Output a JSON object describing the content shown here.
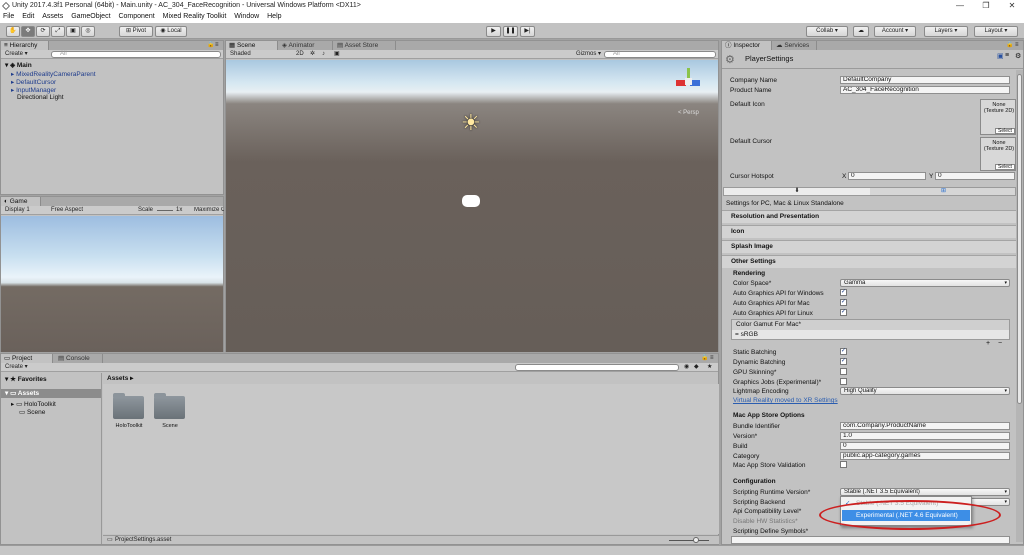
{
  "window": {
    "title": "Unity 2017.4.3f1 Personal (64bit) - Main.unity - AC_304_FaceRecognition - Universal Windows Platform <DX11>",
    "minimize": "—",
    "maximize": "❐",
    "close": "✕"
  },
  "menu": [
    "File",
    "Edit",
    "Assets",
    "GameObject",
    "Component",
    "Mixed Reality Toolkit",
    "Window",
    "Help"
  ],
  "toolbar": {
    "pivot": "Pivot",
    "local": "Local",
    "collab": "Collab ▾",
    "account": "Account",
    "layers": "Layers",
    "layout": "Layout"
  },
  "hierarchy": {
    "tab": "Hierarchy",
    "create": "Create ▾",
    "search_placeholder": "All",
    "scene": "Main",
    "items": [
      "MixedRealityCameraParent",
      "DefaultCursor",
      "InputManager",
      "Directional Light"
    ]
  },
  "scene": {
    "tabs": [
      "Scene",
      "Animator",
      "Asset Store"
    ],
    "shading": "Shaded",
    "mode2d": "2D",
    "gizmos": "Gizmos ▾",
    "search_placeholder": "All",
    "persp": "< Persp"
  },
  "game": {
    "tab": "Game",
    "display": "Display 1",
    "aspect": "Free Aspect",
    "scale_label": "Scale",
    "scale_value": "1x",
    "maximize": "Maximize O"
  },
  "project": {
    "tabs": [
      "Project",
      "Console"
    ],
    "create": "Create ▾",
    "favorites": "Favorites",
    "assets_root": "Assets",
    "tree": [
      "HoloToolkit",
      "Scene"
    ],
    "breadcrumb": "Assets ▸",
    "folders": [
      "HoloToolkit",
      "Scene"
    ],
    "footer_file": "ProjectSettings.asset"
  },
  "inspector": {
    "tabs": [
      "Inspector",
      "Services"
    ],
    "header_title": "PlayerSettings",
    "company_label": "Company Name",
    "company_value": "DefaultCompany",
    "product_label": "Product Name",
    "product_value": "AC_304_FaceRecognition",
    "default_icon_label": "Default Icon",
    "default_cursor_label": "Default Cursor",
    "texture_none": "None (Texture 2D)",
    "select": "Select",
    "cursor_hotspot_label": "Cursor Hotspot",
    "hotspot_x_label": "X",
    "hotspot_x": "0",
    "hotspot_y_label": "Y",
    "hotspot_y": "0",
    "platform_caption": "Settings for PC, Mac & Linux Standalone",
    "sections": {
      "resolution": "Resolution and Presentation",
      "icon": "Icon",
      "splash": "Splash Image",
      "other": "Other Settings"
    },
    "rendering_header": "Rendering",
    "color_space_label": "Color Space*",
    "color_space_value": "Gamma",
    "auto_win_label": "Auto Graphics API for Windows",
    "auto_mac_label": "Auto Graphics API for Mac",
    "auto_linux_label": "Auto Graphics API for Linux",
    "color_gamut_label": "Color Gamut For Mac*",
    "color_gamut_item": "sRGB",
    "list_add": "+",
    "list_remove": "−",
    "static_batching_label": "Static Batching",
    "dynamic_batching_label": "Dynamic Batching",
    "gpu_skinning_label": "GPU Skinning*",
    "graphics_jobs_label": "Graphics Jobs (Experimental)*",
    "lightmap_label": "Lightmap Encoding",
    "lightmap_value": "High Quality",
    "vr_link": "Virtual Reality moved to XR Settings",
    "mac_store_header": "Mac App Store Options",
    "bundle_label": "Bundle Identifier",
    "bundle_value": "com.Company.ProductName",
    "version_label": "Version*",
    "version_value": "1.0",
    "build_label": "Build",
    "build_value": "0",
    "category_label": "Category",
    "category_value": "public.app-category.games",
    "receipt_label": "Mac App Store Validation",
    "config_header": "Configuration",
    "runtime_label": "Scripting Runtime Version*",
    "runtime_value": "Stable (.NET 3.5 Equivalent)",
    "backend_label": "Scripting Backend",
    "api_label": "Api Compatibility Level*",
    "hwstats_label": "Disable HW Statistics*",
    "define_label": "Scripting Define Symbols*",
    "popup_option_1": "Stable (.NET 3.5 Equivalent)",
    "popup_option_2": "Experimental (.NET 4.6 Equivalent)"
  },
  "colors": {
    "accent_blue": "#3d8ee6",
    "highlight_ring": "#cc1f1f",
    "sky_top": "#a9c8e0",
    "ground": "#6a615b"
  }
}
